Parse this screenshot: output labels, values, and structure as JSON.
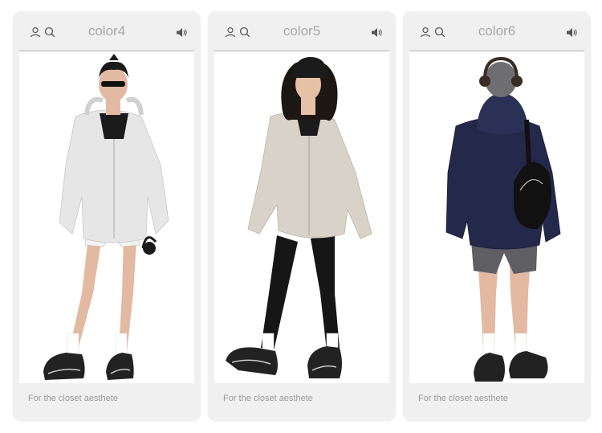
{
  "cards": [
    {
      "title": "color4",
      "caption": "For the closet aesthete",
      "hoodie_color": "#e6e6e6",
      "bottom_color": "#f2f2f2",
      "view": "front"
    },
    {
      "title": "color5",
      "caption": "For the closet aesthete",
      "hoodie_color": "#d9d2c9",
      "bottom_color": "#1a1a1a",
      "view": "front"
    },
    {
      "title": "color6",
      "caption": "For the closet aesthete",
      "hoodie_color": "#24284a",
      "bottom_color": "#5e5e63",
      "view": "back"
    }
  ],
  "icons": {
    "user": "user-icon",
    "search": "search-icon",
    "sound": "speaker-icon"
  }
}
